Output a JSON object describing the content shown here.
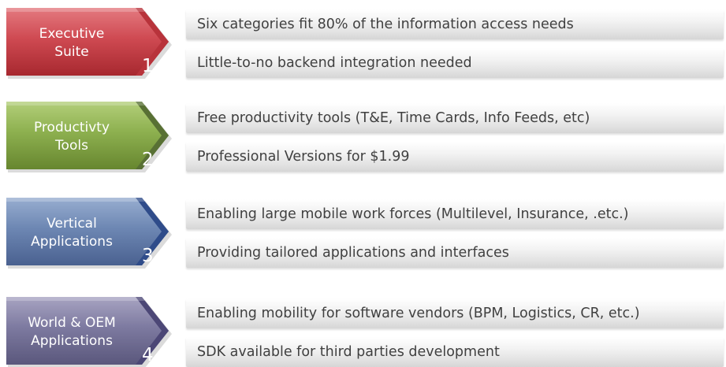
{
  "rows": [
    {
      "label": "Executive\nSuite",
      "number": "1",
      "colors": {
        "top": "#e47a80",
        "mid": "#cf4a52",
        "bottom": "#a7282f",
        "tip": "#b8333b"
      },
      "bars": [
        "Six categories fit 80% of the information access needs",
        "Little-to-no backend integration needed"
      ]
    },
    {
      "label": "Productivty\nTools",
      "number": "2",
      "colors": {
        "top": "#b3cf7a",
        "mid": "#8db04f",
        "bottom": "#67862f",
        "tip": "#587034"
      },
      "bars": [
        "Free productivity tools (T&E, Time Cards, Info Feeds, etc)",
        "Professional Versions for $1.99"
      ]
    },
    {
      "label": "Vertical\nApplications",
      "number": "3",
      "colors": {
        "top": "#98aed0",
        "mid": "#6d87b3",
        "bottom": "#4a6190",
        "tip": "#2f4c8a"
      },
      "bars": [
        "Enabling large mobile work forces (Multilevel, Insurance, .etc.)",
        "Providing tailored applications and interfaces"
      ]
    },
    {
      "label": "World & OEM\nApplications",
      "number": "4",
      "colors": {
        "top": "#a8a4c2",
        "mid": "#7d7aa0",
        "bottom": "#5a577c",
        "tip": "#4c4776"
      },
      "bars": [
        "Enabling mobility for software vendors (BPM, Logistics, CR, etc.)",
        "SDK available for third parties development"
      ]
    }
  ]
}
